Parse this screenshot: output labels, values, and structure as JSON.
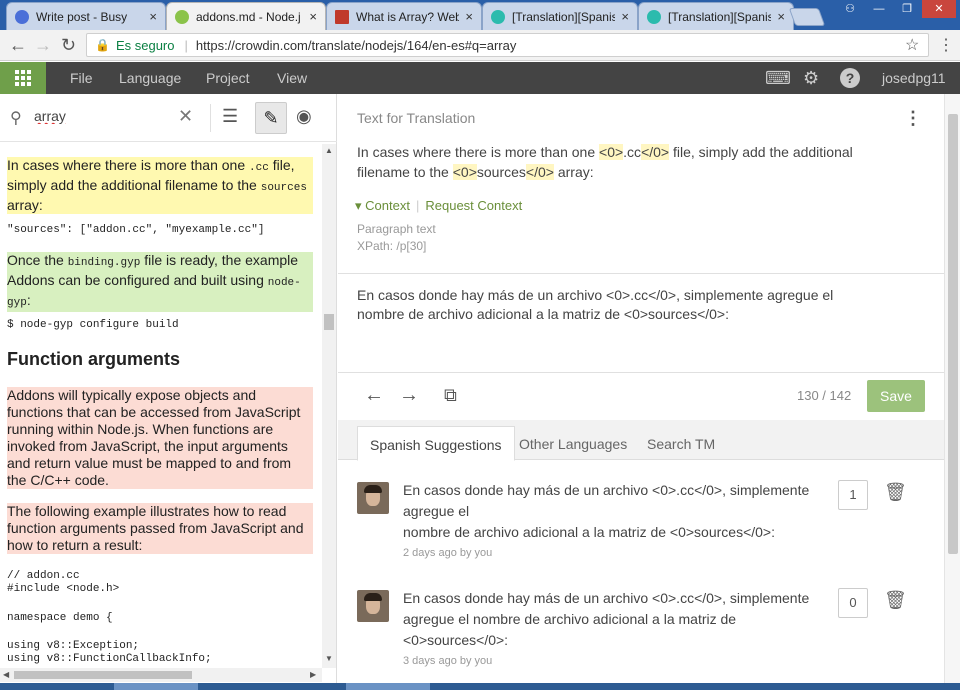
{
  "browser": {
    "tabs": [
      {
        "title": "Write post - Busy",
        "favicon_color": "#4a6fd8"
      },
      {
        "title": "addons.md - Node.j",
        "favicon_color": "#8bc34a"
      },
      {
        "title": "What is Array? Web",
        "favicon_color": "#c0392b"
      },
      {
        "title": "[Translation][Spanis",
        "favicon_color": "#2bbbad"
      },
      {
        "title": "[Translation][Spanis",
        "favicon_color": "#2bbbad"
      }
    ],
    "tab_close": "×",
    "secure_label": "Es seguro",
    "url": "https://crowdin.com/translate/nodejs/164/en-es#q=array",
    "window_controls": [
      "—",
      "❐",
      "✕"
    ]
  },
  "appbar": {
    "menus": [
      "File",
      "Language",
      "Project",
      "View"
    ],
    "username": "josedpg11",
    "icons": [
      "keyboard-icon",
      "gear-icon",
      "help-icon"
    ]
  },
  "leftpane": {
    "search_value": "array",
    "doc": {
      "p1_a": "In cases where there is more than one ",
      "p1_code1": ".cc",
      "p1_b": " file, simply add the additional filename to the ",
      "p1_code2": "sources",
      "p1_c": " array:",
      "code1": "\"sources\": [\"addon.cc\", \"myexample.cc\"]",
      "p2_a": "Once the ",
      "p2_code1": "binding.gyp",
      "p2_b": " file is ready, the example Addons can be configured and built using ",
      "p2_code2": "node-gyp",
      "p2_c": ":",
      "code2": "$ node-gyp configure build",
      "heading": "Function arguments",
      "p3": "Addons will typically expose objects and functions that can be accessed from JavaScript running within Node.js. When functions are invoked from JavaScript, the input arguments and return value must be mapped to and from the C/C++ code.",
      "p4": "The following example illustrates how to read function arguments passed from JavaScript and how to return a result:",
      "code3": "// addon.cc\n#include <node.h>",
      "code4": "namespace demo {",
      "code5": "using v8::Exception;\nusing v8::FunctionCallbackInfo;"
    }
  },
  "rightpane": {
    "text_for_translation_label": "Text for Translation",
    "source": {
      "a": "In cases where there is more than one ",
      "t1": "<0>",
      "b": ".cc",
      "t2": "</0>",
      "c": " file, simply add the additional filename to the ",
      "t3": "<0>",
      "d": "sources",
      "t4": "</0>",
      "e": " array:"
    },
    "context_label": "Context",
    "request_context_label": "Request Context",
    "paragraph_label": "Paragraph text",
    "xpath_label": "XPath: /p[30]",
    "translation": "En casos donde hay más de un archivo <0>.cc</0>, simplemente agregue el nombre de archivo adicional a la matriz de <0>sources</0>:",
    "counter": "130 / 142",
    "save_label": "Save",
    "tabs": [
      "Spanish Suggestions",
      "Other Languages",
      "Search TM"
    ],
    "suggestions": [
      {
        "text": "En casos donde hay más de un archivo <0>.cc</0>, simplemente agregue el\nnombre de archivo adicional a la matriz de <0>sources</0>:",
        "meta": "2 days ago by you",
        "votes": "1"
      },
      {
        "text": "En casos donde hay más de un archivo <0>.cc</0>, simplemente agregue el nombre de archivo adicional a la matriz de <0>sources</0>:",
        "meta": "3 days ago by you",
        "votes": "0"
      }
    ]
  },
  "colors": {
    "accent_green": "#6f9f4a",
    "save_button": "#9cc27c",
    "appbar_bg": "#444444",
    "highlight_yellow": "#fff9b0",
    "highlight_green": "#d8f0c0",
    "highlight_red": "#fcdcd4"
  }
}
